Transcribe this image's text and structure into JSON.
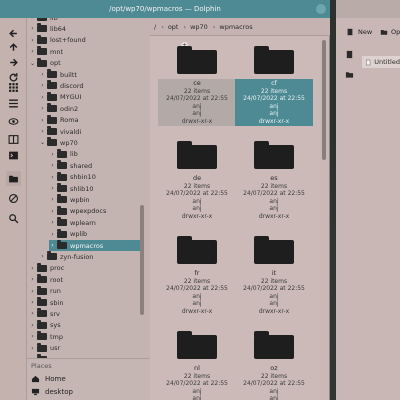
{
  "window": {
    "title": "/opt/wp70/wpmacros — Dolphin"
  },
  "breadcrumb": [
    "/",
    "opt",
    "wp70",
    "wpmacros"
  ],
  "tree": [
    {
      "label": "lib",
      "depth": 1,
      "open": false,
      "y": 18,
      "partial": true
    },
    {
      "label": "lib64",
      "depth": 1,
      "open": false
    },
    {
      "label": "lost+found",
      "depth": 1,
      "open": false
    },
    {
      "label": "mnt",
      "depth": 1,
      "open": false
    },
    {
      "label": "opt",
      "depth": 1,
      "open": true
    },
    {
      "label": "builtt",
      "depth": 2,
      "open": false
    },
    {
      "label": "discord",
      "depth": 2,
      "open": false
    },
    {
      "label": "MYGUI",
      "depth": 2,
      "open": false
    },
    {
      "label": "odin2",
      "depth": 2,
      "open": false
    },
    {
      "label": "Roma",
      "depth": 2,
      "open": false
    },
    {
      "label": "vivaldi",
      "depth": 2,
      "open": false
    },
    {
      "label": "wp70",
      "depth": 2,
      "open": true
    },
    {
      "label": "lib",
      "depth": 3,
      "open": false
    },
    {
      "label": "shared",
      "depth": 3,
      "open": false
    },
    {
      "label": "shbin10",
      "depth": 3,
      "open": false
    },
    {
      "label": "shlib10",
      "depth": 3,
      "open": false
    },
    {
      "label": "wpbin",
      "depth": 3,
      "open": false
    },
    {
      "label": "wpexpdocs",
      "depth": 3,
      "open": false
    },
    {
      "label": "wplearn",
      "depth": 3,
      "open": false
    },
    {
      "label": "wplib",
      "depth": 3,
      "open": false
    },
    {
      "label": "wpmacros",
      "depth": 3,
      "open": false,
      "selected": true
    },
    {
      "label": "zyn-fusion",
      "depth": 2,
      "open": false
    },
    {
      "label": "proc",
      "depth": 1,
      "open": false
    },
    {
      "label": "root",
      "depth": 1,
      "open": false
    },
    {
      "label": "run",
      "depth": 1,
      "open": false
    },
    {
      "label": "sbin",
      "depth": 1,
      "open": false
    },
    {
      "label": "srv",
      "depth": 1,
      "open": false
    },
    {
      "label": "sys",
      "depth": 1,
      "open": false
    },
    {
      "label": "tmp",
      "depth": 1,
      "open": false
    },
    {
      "label": "usr",
      "depth": 1,
      "open": false
    },
    {
      "label": "var",
      "depth": 1,
      "open": false
    }
  ],
  "places": {
    "title": "Places",
    "items": [
      "Home",
      "desktop"
    ]
  },
  "files": [
    {
      "name": "ce",
      "items": "22 items",
      "date": "24/07/2022 at 22:55",
      "owner": "anj",
      "group": "anj",
      "perms": "drwxr-xr-x",
      "state": "hover"
    },
    {
      "name": "cf",
      "items": "22 items",
      "date": "24/07/2022 at 22:55",
      "owner": "anj",
      "group": "anj",
      "perms": "drwxr-xr-x",
      "state": "selected"
    },
    {
      "name": "de",
      "items": "22 items",
      "date": "24/07/2022 at 22:55",
      "owner": "anj",
      "group": "anj",
      "perms": "drwxr-xr-x"
    },
    {
      "name": "es",
      "items": "22 items",
      "date": "24/07/2022 at 22:55",
      "owner": "anj",
      "group": "anj",
      "perms": "drwxr-xr-x"
    },
    {
      "name": "fr",
      "items": "22 items",
      "date": "24/07/2022 at 22:55",
      "owner": "anj",
      "group": "anj",
      "perms": "drwxr-xr-x"
    },
    {
      "name": "it",
      "items": "22 items",
      "date": "24/07/2022 at 22:55",
      "owner": "anj",
      "group": "anj",
      "perms": "drwxr-xr-x"
    },
    {
      "name": "nl",
      "items": "22 items",
      "date": "24/07/2022 at 22:55",
      "owner": "anj",
      "group": "anj",
      "perms": "drwxr-xr-x"
    },
    {
      "name": "oz",
      "items": "22 items",
      "date": "24/07/2022 at 22:55",
      "owner": "anj",
      "group": "anj",
      "perms": "drwxr-xr-x"
    }
  ],
  "second_window": {
    "new_label": "New",
    "open_label": "Op",
    "tab_label": "Untitled"
  },
  "colors": {
    "accent": "#4e8a94",
    "panel": "#c9b8b5"
  },
  "toolbar_icons": [
    "back-icon",
    "up-icon",
    "forward-icon",
    "refresh-icon",
    "grid-view-icon",
    "list-view-icon",
    "preview-icon",
    "split-icon",
    "terminal-icon",
    "folder-icon",
    "hidden-files-icon",
    "search-icon"
  ]
}
